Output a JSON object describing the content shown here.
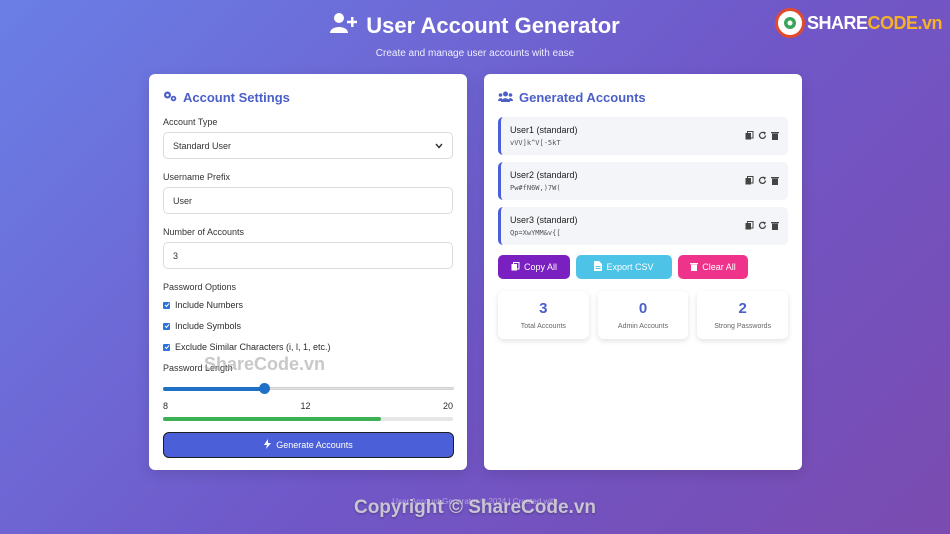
{
  "header": {
    "title": "User Account Generator",
    "subtitle": "Create and manage user accounts with ease"
  },
  "brand": {
    "logo_prefix": "SHARE",
    "logo_suffix": "CODE.vn"
  },
  "settings": {
    "title": "Account Settings",
    "account_type_label": "Account Type",
    "account_type_value": "Standard User",
    "prefix_label": "Username Prefix",
    "prefix_value": "User",
    "count_label": "Number of Accounts",
    "count_value": "3",
    "options_label": "Password Options",
    "options": [
      {
        "label": "Include Numbers",
        "checked": true
      },
      {
        "label": "Include Symbols",
        "checked": true
      },
      {
        "label": "Exclude Similar Characters (i, l, 1, etc.)",
        "checked": true
      }
    ],
    "length_label": "Password Length",
    "length_min": "8",
    "length_value": "12",
    "length_max": "20",
    "strength_fraction": 0.75,
    "generate_label": "Generate Accounts"
  },
  "generated": {
    "title": "Generated Accounts",
    "accounts": [
      {
        "name": "User1 (standard)",
        "password": "vVV]k^V[-5kT"
      },
      {
        "name": "User2 (standard)",
        "password": "Pw#fN6W,)7W("
      },
      {
        "name": "User3 (standard)",
        "password": "Qp=XwYMM&v{["
      }
    ],
    "buttons": {
      "copy_all": "Copy All",
      "export_csv": "Export CSV",
      "clear_all": "Clear All"
    },
    "stats": [
      {
        "value": "3",
        "label": "Total Accounts"
      },
      {
        "value": "0",
        "label": "Admin Accounts"
      },
      {
        "value": "2",
        "label": "Strong Passwords"
      }
    ]
  },
  "watermarks": {
    "mid": "ShareCode.vn",
    "footer": "Copyright © ShareCode.vn",
    "footer_faint": "User Account Generator © 2024 | Created with"
  },
  "colors": {
    "accent": "#4a5fd8",
    "copy_btn": "#7a1fc0",
    "export_btn": "#4ec3e8",
    "clear_btn": "#f0338a",
    "strength": "#3cb055"
  }
}
